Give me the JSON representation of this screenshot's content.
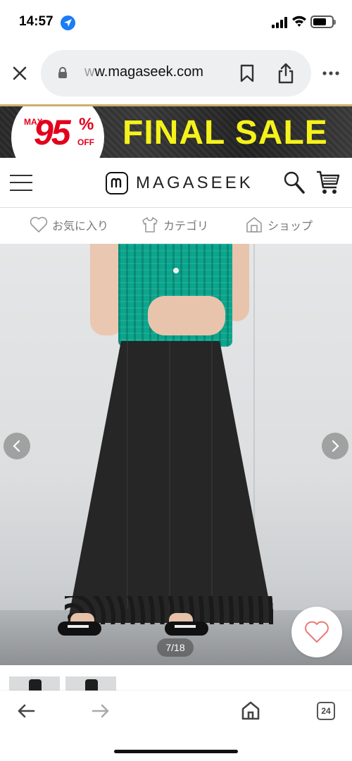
{
  "status_bar": {
    "time": "14:57"
  },
  "browser": {
    "url_faded": "w",
    "url": "w.magaseek.com"
  },
  "banner": {
    "max_label": "MAX",
    "percent": "95",
    "percent_sign": "%",
    "off_label": "OFF",
    "headline": "FINAL SALE"
  },
  "site": {
    "logo_text": "MAGASEEK",
    "nav": [
      {
        "label": "お気に入り",
        "icon": "heart-icon"
      },
      {
        "label": "カテゴリ",
        "icon": "shirt-icon"
      },
      {
        "label": "ショップ",
        "icon": "shop-icon"
      }
    ]
  },
  "gallery": {
    "counter": "7/18"
  },
  "toolbar": {
    "tab_count": "24"
  }
}
